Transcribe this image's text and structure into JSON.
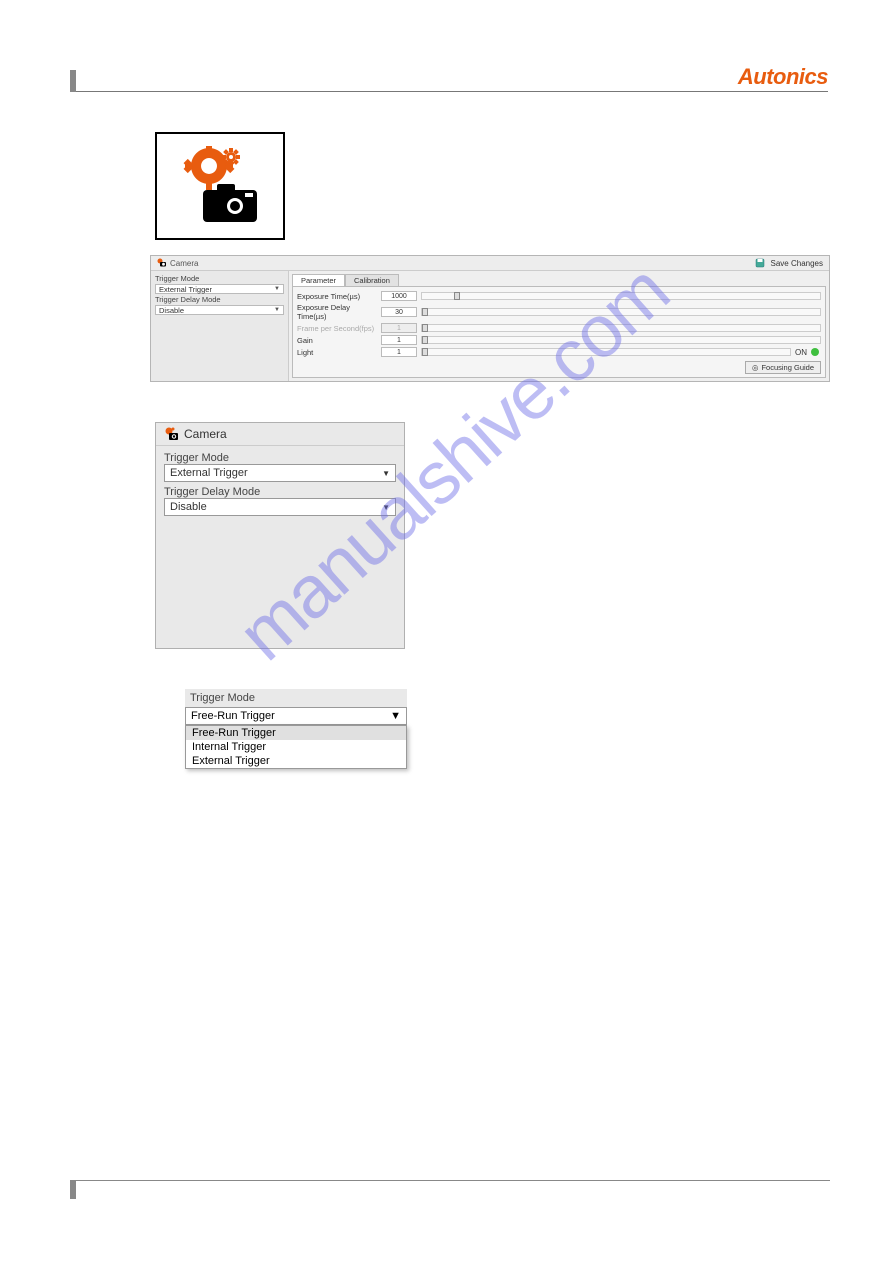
{
  "brand": "Autonics",
  "watermark": "manualshive.com",
  "panel": {
    "title": "Camera",
    "save_label": "Save Changes",
    "left": {
      "trigger_mode_label": "Trigger Mode",
      "trigger_mode_value": "External Trigger",
      "trigger_delay_mode_label": "Trigger Delay Mode",
      "trigger_delay_mode_value": "Disable"
    },
    "tabs": {
      "parameter": "Parameter",
      "calibration": "Calibration"
    },
    "params": {
      "exposure_time_label": "Exposure Time(µs)",
      "exposure_time_value": "1000",
      "exposure_delay_label": "Exposure Delay Time(µs)",
      "exposure_delay_value": "30",
      "fps_label": "Frame per Second(fps)",
      "fps_value": "1",
      "gain_label": "Gain",
      "gain_value": "1",
      "light_label": "Light",
      "light_value": "1",
      "on_label": "ON"
    },
    "focusing_guide": "Focusing Guide"
  },
  "zoom": {
    "title": "Camera",
    "trigger_mode_label": "Trigger Mode",
    "trigger_mode_value": "External Trigger",
    "trigger_delay_mode_label": "Trigger Delay Mode",
    "trigger_delay_mode_value": "Disable"
  },
  "trigger_dropdown": {
    "label": "Trigger Mode",
    "selected": "Free-Run Trigger",
    "options": [
      "Free-Run Trigger",
      "Internal Trigger",
      "External Trigger"
    ]
  }
}
